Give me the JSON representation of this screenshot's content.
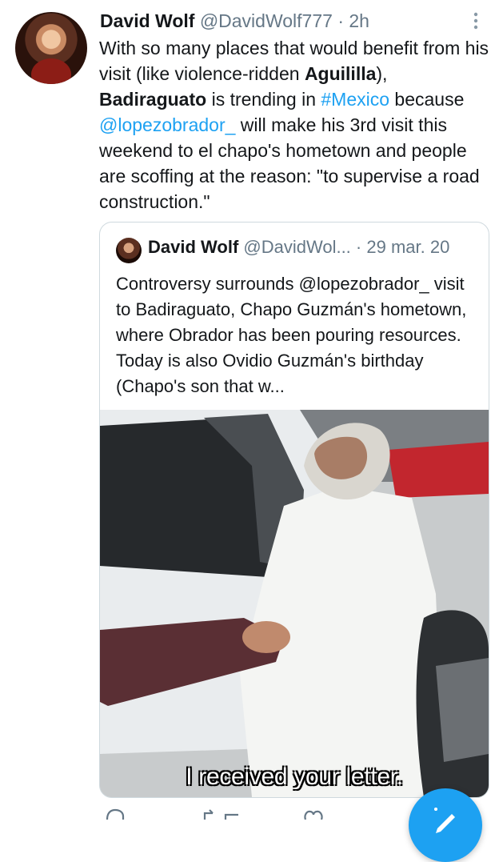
{
  "tweet": {
    "display_name": "David Wolf",
    "handle": "@DavidWolf777",
    "separator": "·",
    "time": "2h",
    "body_parts": [
      {
        "text": "With so many places that would benefit from his visit (like violence-ridden ",
        "style": "plain"
      },
      {
        "text": "Aguililla",
        "style": "bold"
      },
      {
        "text": "), ",
        "style": "plain"
      },
      {
        "text": "Badiraguato",
        "style": "bold"
      },
      {
        "text": " is trending in ",
        "style": "plain"
      },
      {
        "text": "#Mexico",
        "style": "link"
      },
      {
        "text": " because ",
        "style": "plain"
      },
      {
        "text": "@lopezobrador_",
        "style": "link"
      },
      {
        "text": " will make his 3rd visit this weekend to el chapo's hometown and people are scoffing at the reason: \"to supervise a road construction.\"",
        "style": "plain"
      }
    ]
  },
  "quoted_tweet": {
    "display_name": "David Wolf",
    "handle": "@DavidWol...",
    "separator": "·",
    "date": "29 mar. 20",
    "body": "Controversy surrounds @lopezobrador_ visit to Badiraguato, Chapo Guzmán's hometown, where Obrador has been pouring resources. Today is also Ovidio Guzmán's birthday (Chapo's son that w...",
    "media_caption": "I received your letter."
  },
  "icons": {
    "more": "vertical-dots-icon",
    "reply": "reply-icon",
    "retweet": "retweet-icon",
    "like": "heart-icon",
    "compose": "compose-tweet-icon"
  },
  "colors": {
    "link": "#1da1f2",
    "meta": "#657786",
    "fab": "#1da1f2"
  }
}
